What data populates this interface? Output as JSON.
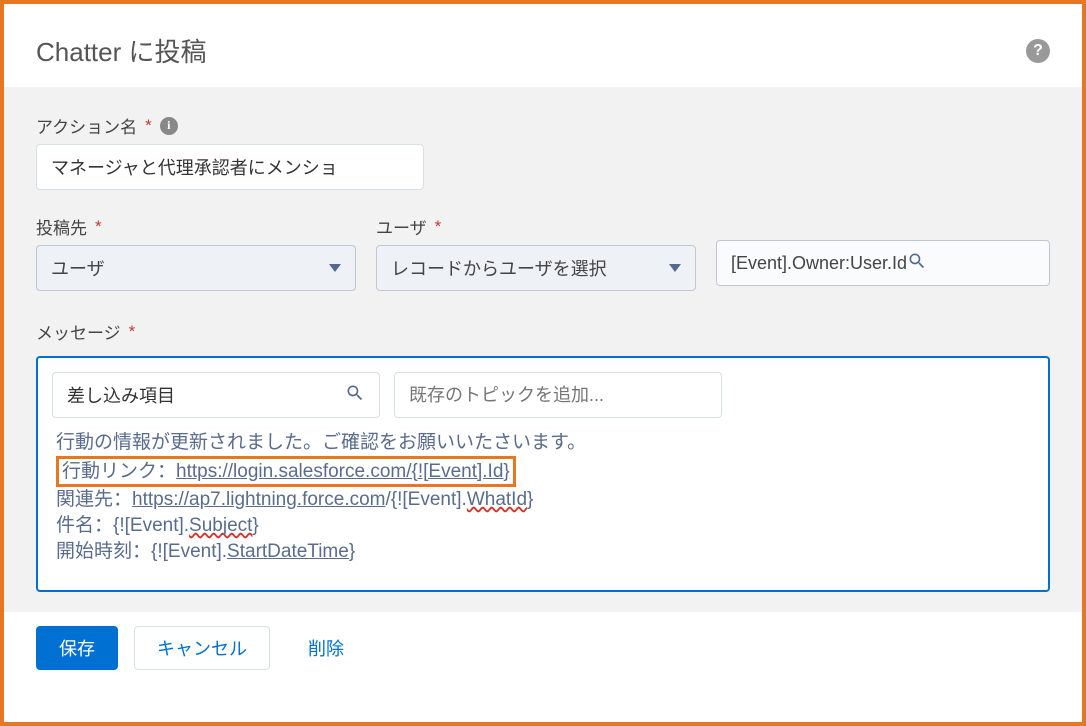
{
  "header": {
    "title": "Chatter に投稿"
  },
  "actionName": {
    "label": "アクション名",
    "value": "マネージャと代理承認者にメンショ"
  },
  "destination": {
    "label": "投稿先",
    "value": "ユーザ"
  },
  "user": {
    "label": "ユーザ",
    "value": "レコードからユーザを選択"
  },
  "userSearch": {
    "value": "[Event].Owner:User.Id"
  },
  "message": {
    "label": "メッセージ",
    "mergeFieldLabel": "差し込み項目",
    "topicPlaceholder": "既存のトピックを追加...",
    "body": {
      "line1": "行動の情報が更新されました。ご確認をお願いいたさいます。",
      "line2_prefix": "行動リンク：",
      "line2_link": "https://login.salesforce.com/{![Event].Id}",
      "line3_prefix": "関連先：",
      "line3_link_a": "https://ap7.lightning.force.com",
      "line3_link_b": "/{![Event].",
      "line3_link_c": "WhatId",
      "line3_link_d": "}",
      "line4_prefix": "件名：{![Event].",
      "line4_mid": "Subject",
      "line4_end": "}",
      "line5_prefix": "開始時刻：{![Event].",
      "line5_mid": "StartDateTime",
      "line5_end": "}"
    }
  },
  "buttons": {
    "save": "保存",
    "cancel": "キャンセル",
    "delete": "削除"
  }
}
